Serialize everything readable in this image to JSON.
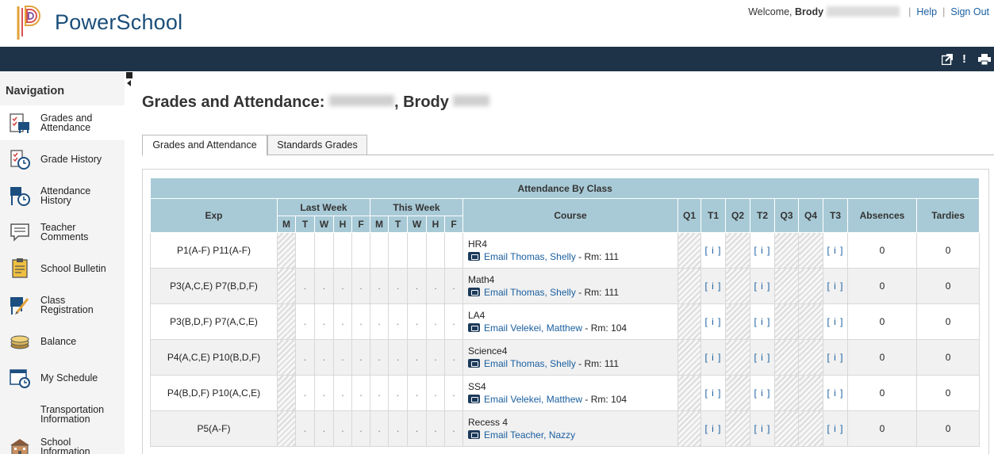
{
  "header": {
    "brand": "PowerSchool",
    "welcome": "Welcome,",
    "user_first": "Brody",
    "help": "Help",
    "sign_out": "Sign Out",
    "sep": "|"
  },
  "navigation": {
    "title": "Navigation",
    "items": [
      {
        "label": "Grades and Attendance",
        "icon": "grades-attendance-icon",
        "active": true
      },
      {
        "label": "Grade History",
        "icon": "grade-history-icon"
      },
      {
        "label": "Attendance History",
        "icon": "attendance-history-icon"
      },
      {
        "label": "Teacher Comments",
        "icon": "teacher-comments-icon"
      },
      {
        "label": "School Bulletin",
        "icon": "school-bulletin-icon"
      },
      {
        "label": "Class Registration",
        "icon": "class-registration-icon"
      },
      {
        "label": "Balance",
        "icon": "balance-icon"
      },
      {
        "label": "My Schedule",
        "icon": "my-schedule-icon"
      },
      {
        "label": "Transportation Information",
        "icon": ""
      },
      {
        "label": "School Information",
        "icon": "school-information-icon"
      }
    ]
  },
  "page": {
    "title_prefix": "Grades and Attendance:",
    "title_comma": ",",
    "title_first": "Brody"
  },
  "tabs": [
    {
      "label": "Grades and Attendance",
      "active": true
    },
    {
      "label": "Standards Grades",
      "active": false
    }
  ],
  "table": {
    "caption": "Attendance By Class",
    "headers": {
      "exp": "Exp",
      "last_week": "Last Week",
      "this_week": "This Week",
      "course": "Course",
      "q1": "Q1",
      "t1": "T1",
      "q2": "Q2",
      "t2": "T2",
      "q3": "Q3",
      "q4": "Q4",
      "t3": "T3",
      "absences": "Absences",
      "tardies": "Tardies"
    },
    "days": [
      "M",
      "T",
      "W",
      "H",
      "F",
      "M",
      "T",
      "W",
      "H",
      "F"
    ],
    "dot": ".",
    "grade_link": "[ i ]",
    "email_prefix": "Email",
    "room_sep": " - Rm: ",
    "rows": [
      {
        "exp": "P1(A-F) P11(A-F)",
        "course": "HR4",
        "teacher": "Thomas, Shelly",
        "room": "111",
        "absences": "0",
        "tardies": "0",
        "dots": false
      },
      {
        "exp": "P3(A,C,E) P7(B,D,F)",
        "course": "Math4",
        "teacher": "Thomas, Shelly",
        "room": "111",
        "absences": "0",
        "tardies": "0",
        "dots": true
      },
      {
        "exp": "P3(B,D,F) P7(A,C,E)",
        "course": "LA4",
        "teacher": "Velekei, Matthew",
        "room": "104",
        "absences": "0",
        "tardies": "0",
        "dots": true
      },
      {
        "exp": "P4(A,C,E) P10(B,D,F)",
        "course": "Science4",
        "teacher": "Thomas, Shelly",
        "room": "111",
        "absences": "0",
        "tardies": "0",
        "dots": true
      },
      {
        "exp": "P4(B,D,F) P10(A,C,E)",
        "course": "SS4",
        "teacher": "Velekei, Matthew",
        "room": "104",
        "absences": "0",
        "tardies": "0",
        "dots": true
      },
      {
        "exp": "P5(A-F)",
        "course": "Recess 4",
        "teacher": "Teacher, Nazzy",
        "room": "",
        "absences": "0",
        "tardies": "0",
        "dots": true
      }
    ]
  },
  "colors": {
    "toolbar": "#1e3347",
    "table_header": "#a8cad6",
    "link": "#1a5fa0",
    "brand": "#1a4e7a"
  }
}
